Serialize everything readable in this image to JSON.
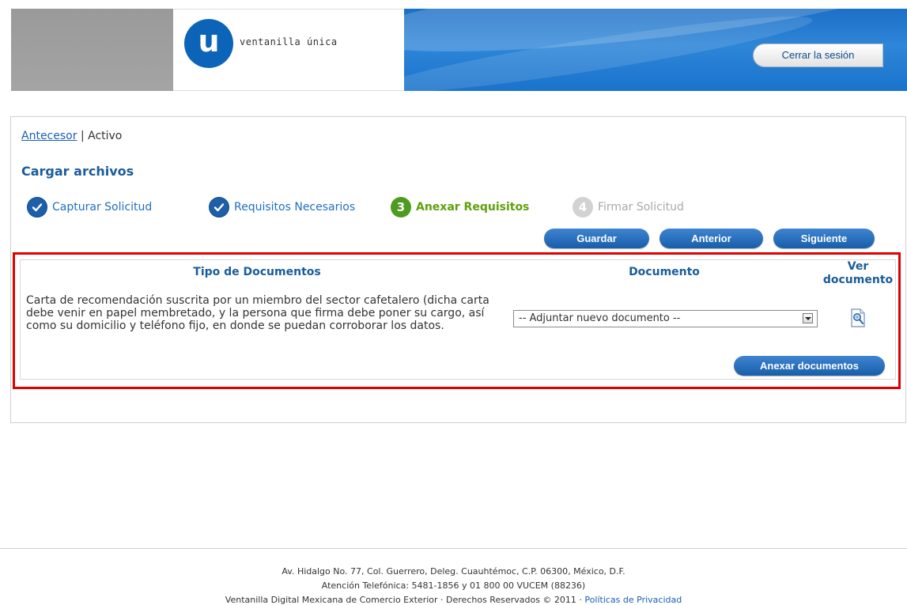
{
  "header": {
    "logo_letter": "u",
    "logo_text": "ventanilla única",
    "logout_label": "Cerrar la sesión"
  },
  "breadcrumb": {
    "previous": "Antecesor",
    "separator": "|",
    "current": "Activo"
  },
  "page_title": "Cargar archivos",
  "steps": [
    {
      "label": "Capturar Solicitud",
      "state": "done"
    },
    {
      "label": "Requisitos Necesarios",
      "state": "done"
    },
    {
      "number": "3",
      "label": "Anexar Requisitos",
      "state": "active"
    },
    {
      "number": "4",
      "label": "Firmar Solicitud",
      "state": "pending"
    }
  ],
  "actions": {
    "save": "Guardar",
    "previous": "Anterior",
    "next": "Siguiente"
  },
  "table": {
    "col_type": "Tipo de Documentos",
    "col_document": "Documento",
    "col_view_line1": "Ver",
    "col_view_line2": "documento",
    "rows": [
      {
        "description": "Carta de recomendación suscrita por un miembro del sector cafetalero (dicha carta debe venir en papel membretado, y la persona que firma debe poner su cargo, así como su domicilio y teléfono fijo, en donde se puedan corroborar los datos.",
        "select_value": "-- Adjuntar nuevo documento --",
        "view_icon": "document-magnifier-icon"
      }
    ],
    "attach_button": "Anexar documentos"
  },
  "footer": {
    "address": "Av. Hidalgo No. 77, Col. Guerrero, Deleg. Cuauhtémoc, C.P. 06300, México, D.F.",
    "phone": "Atención Telefónica: 5481-1856 y 01 800 00 VUCEM (88236)",
    "rights": "Ventanilla Digital Mexicana de Comercio Exterior · Derechos Reservados © 2011 · ",
    "privacy_link": "Políticas de Privacidad"
  },
  "colors": {
    "brand_blue": "#0b64b8",
    "title_blue": "#1a5c99",
    "active_green": "#5ea10b",
    "highlight_red": "#e00000"
  }
}
